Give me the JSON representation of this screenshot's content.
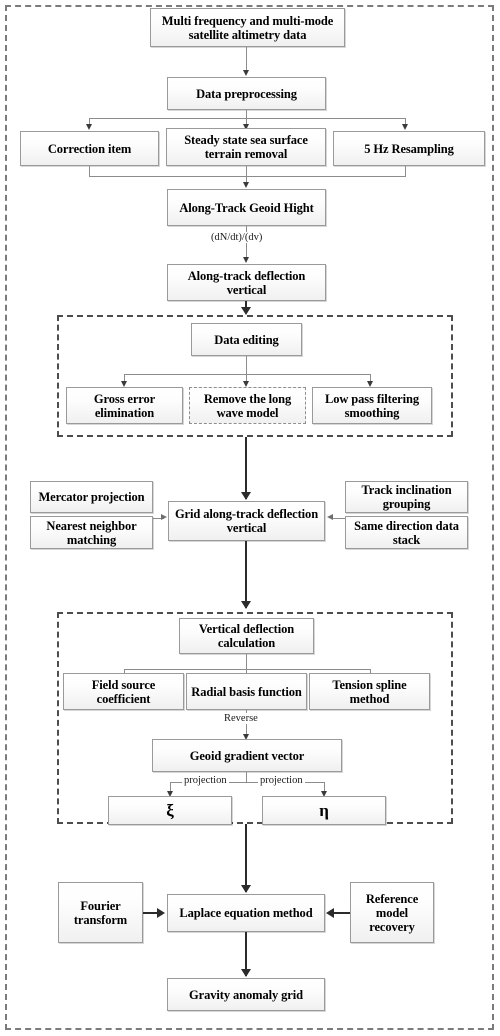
{
  "diagram": {
    "title": "Satellite altimetry gravity anomaly derivation flowchart",
    "boxes": {
      "source_data": "Multi frequency and multi-mode satellite altimetry data",
      "data_preprocessing": "Data preprocessing",
      "correction_item": "Correction item",
      "steady_state": "Steady state sea surface terrain removal",
      "resampling": "5 Hz Resampling",
      "geoid_height": "Along-Track Geoid Hight",
      "along_track_deflection": "Along-track deflection vertical",
      "data_editing": "Data editing",
      "gross_error": "Gross error elimination",
      "remove_long_wave": "Remove the long wave model",
      "low_pass": "Low pass filtering smoothing",
      "mercator": "Mercator projection",
      "nearest_neighbor": "Nearest neighbor matching",
      "grid_along_track": "Grid along-track deflection vertical",
      "track_inclination": "Track inclination grouping",
      "same_direction": "Same direction data stack",
      "vertical_deflection": "Vertical deflection calculation",
      "field_source": "Field source coefficient",
      "radial_basis": "Radial basis function",
      "tension_spline": "Tension spline method",
      "geoid_gradient": "Geoid gradient vector",
      "xi": "ξ",
      "eta": "η",
      "fourier": "Fourier transform",
      "laplace": "Laplace equation method",
      "reference_model": "Reference model recovery",
      "gravity_anomaly": "Gravity anomaly grid"
    },
    "edge_labels": {
      "derivative": "(dN/dt)/(dv)",
      "reverse": "Reverse",
      "projection_left": "projection",
      "projection_right": "projection"
    },
    "colors": {
      "box_border": "#9a9a9a",
      "box_fill_top": "#ffffff",
      "box_fill_bottom": "#f0f0f0",
      "connector": "#2b2b2b",
      "thin_connector": "#8c8c8c",
      "frame_dashed": "#7b7b7b",
      "text": "#000000"
    }
  }
}
